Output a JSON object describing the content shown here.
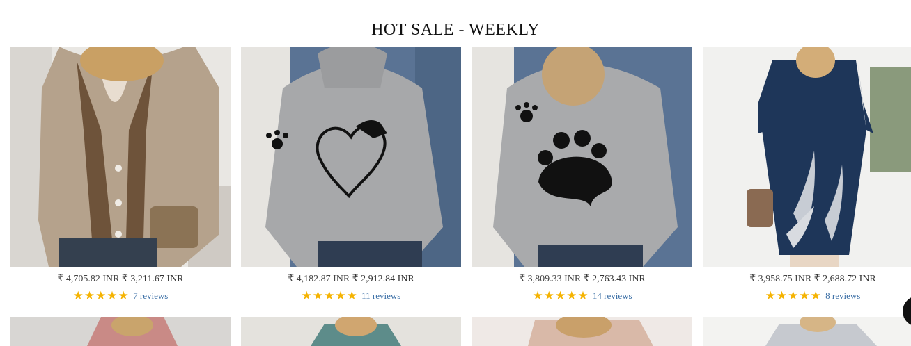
{
  "section": {
    "title": "HOT SALE - WEEKLY"
  },
  "products": [
    {
      "old_price": "₹ 4,705.82 INR",
      "price": "₹ 3,211.67 INR",
      "stars": "★★★★★",
      "reviews": "7 reviews",
      "rating": 5
    },
    {
      "old_price": "₹ 4,182.87 INR",
      "price": "₹ 2,912.84 INR",
      "stars": "★★★★★",
      "reviews": "11 reviews",
      "rating": 5
    },
    {
      "old_price": "₹ 3,809.33 INR",
      "price": "₹ 2,763.43 INR",
      "stars": "★★★★★",
      "reviews": "14 reviews",
      "rating": 5
    },
    {
      "old_price": "₹ 3,958.75 INR",
      "price": "₹ 2,688.72 INR",
      "stars": "★★★★★",
      "reviews": "8 reviews",
      "rating": 5
    }
  ],
  "colors": {
    "star": "#f5b301",
    "link": "#3a6ea5"
  }
}
